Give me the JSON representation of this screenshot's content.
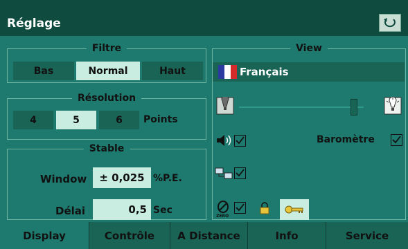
{
  "window": {
    "title": "Réglage"
  },
  "filtre": {
    "legend": "Filtre",
    "options": [
      "Bas",
      "Normal",
      "Haut"
    ],
    "selected": "Normal"
  },
  "resolution": {
    "legend": "Résolution",
    "options": [
      "4",
      "5",
      "6"
    ],
    "selected": "5",
    "unit": "Points"
  },
  "stable": {
    "legend": "Stable",
    "window_label": "Window",
    "window_value": "± 0,025",
    "window_unit": "%P.E.",
    "delai_label": "Délai",
    "delai_value": "0,5",
    "delai_unit": "Sec"
  },
  "view": {
    "legend": "View",
    "language": "Français",
    "flag_colors": [
      "#2b3a9e",
      "#ffffff",
      "#d42a2a"
    ],
    "brightness_level": 0.92,
    "sound_checked": true,
    "barometre_label": "Baromètre",
    "barometre_checked": true,
    "network_checked": true,
    "zero_checked": true,
    "zero_label": "ZERO"
  },
  "tabs": [
    "Display",
    "Contrôle",
    "A Distance",
    "Info",
    "Service"
  ],
  "active_tab": "Display",
  "colors": {
    "background": "#1e7a6e",
    "titlebar": "#0f4c3f",
    "button": "#1a6455",
    "selected": "#c9eee1",
    "key_icon": "#e8c43a"
  }
}
